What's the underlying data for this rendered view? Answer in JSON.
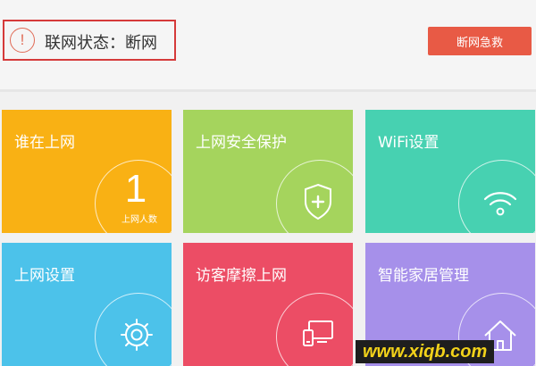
{
  "status": {
    "label": "联网状态：断网",
    "icon": "alert-icon",
    "icon_glyph": "!"
  },
  "actions": {
    "emergency_label": "断网急救"
  },
  "tiles": [
    {
      "label": "谁在上网",
      "color": "#f9b114",
      "icon": "user-count",
      "count": "1",
      "count_caption": "上网人数"
    },
    {
      "label": "上网安全保护",
      "color": "#a5d45d",
      "icon": "shield-plus-icon"
    },
    {
      "label": "WiFi设置",
      "color": "#47d1b1",
      "icon": "wifi-icon"
    },
    {
      "label": "上网设置",
      "color": "#4cc2ea",
      "icon": "gear-icon"
    },
    {
      "label": "访客摩擦上网",
      "color": "#ec4d65",
      "icon": "guest-devices-icon"
    },
    {
      "label": "智能家居管理",
      "color": "#a690ea",
      "icon": "home-icon"
    }
  ],
  "watermark": "www.xiqb.com"
}
